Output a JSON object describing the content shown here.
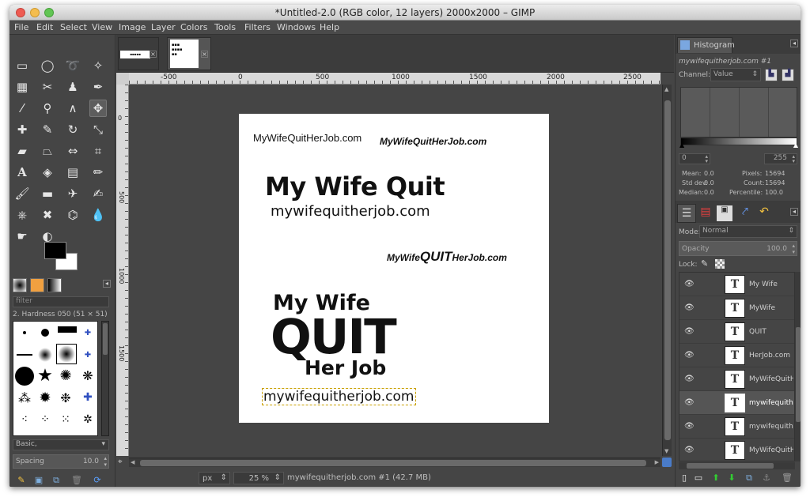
{
  "window": {
    "title": "*Untitled-2.0 (RGB color, 12 layers) 2000x2000 – GIMP"
  },
  "menu": [
    "File",
    "Edit",
    "Select",
    "View",
    "Image",
    "Layer",
    "Colors",
    "Tools",
    "Filters",
    "Windows",
    "Help"
  ],
  "toolbox": {
    "filter_placeholder": "filter",
    "brush_name": "2. Hardness 050 (51 × 51)",
    "preset": "Basic,",
    "spacing_label": "Spacing",
    "spacing_value": "10.0"
  },
  "canvas": {
    "ruler_labels": [
      "-500",
      "0",
      "500",
      "1000",
      "1500",
      "2000",
      "2500"
    ],
    "vruler_labels": [
      "0",
      "500",
      "1000",
      "1500"
    ],
    "texts": {
      "t1": "MyWifeQuitHerJob.com",
      "t2": "MyWifeQuitHerJob.com",
      "t3": "My Wife Quit",
      "t4": "mywifequitherjob.com",
      "t5a": "MyWife",
      "t5b": "QUIT",
      "t5c": "HerJob.com",
      "t6a": "My Wife",
      "t6b": "QUIT",
      "t6c": "Her Job",
      "t7": "mywifequitherjob.com"
    }
  },
  "statusbar": {
    "unit": "px",
    "zoom": "25 %",
    "info": "mywifequitherjob.com #1 (42.7 MB)"
  },
  "histogram": {
    "tab": "Histogram",
    "image_name": "mywifequitherjob.com #1",
    "channel_label": "Channel:",
    "channel_value": "Value",
    "range_min": "0",
    "range_max": "255",
    "stats": {
      "mean_label": "Mean:",
      "mean": "0.0",
      "std_label": "Std dev:",
      "std": "0.0",
      "median_label": "Median:",
      "median": "0.0",
      "pixels_label": "Pixels:",
      "pixels": "15694",
      "count_label": "Count:",
      "count": "15694",
      "percentile_label": "Percentile:",
      "percentile": "100.0"
    }
  },
  "layers": {
    "mode_label": "Mode:",
    "mode_value": "Normal",
    "opacity_label": "Opacity",
    "opacity_value": "100.0",
    "lock_label": "Lock:",
    "items": [
      {
        "name": "My Wife"
      },
      {
        "name": "MyWife"
      },
      {
        "name": "QUIT"
      },
      {
        "name": "HerJob.com"
      },
      {
        "name": "MyWifeQuitH"
      },
      {
        "name": "mywifequith"
      },
      {
        "name": "mywifequith"
      },
      {
        "name": "MyWifeQuitH"
      }
    ],
    "thumb_glyph": "T"
  }
}
